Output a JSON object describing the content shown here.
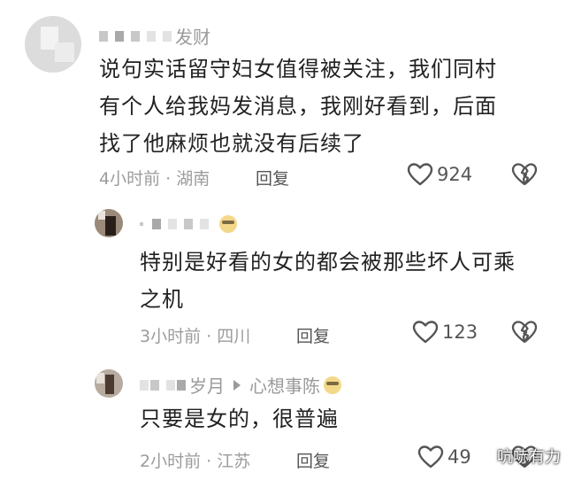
{
  "comments": [
    {
      "name_visible": "发财",
      "text": "说句实话留守妇女值得被关注，我们同村有个人给我妈发消息，我刚好看到，后面找了他麻烦也就没有后续了",
      "lines": [
        "说句实话留守妇女值得被关注，我们同村",
        "有个人给我妈发消息，我刚好看到，后面",
        "找了他麻烦也就没有后续了"
      ],
      "time": "4小时前",
      "location": "湖南",
      "reply_label": "回复",
      "likes": "924"
    },
    {
      "text": "特别是好看的女的都会被那些坏人可乘之机",
      "lines": [
        "特别是好看的女的都会被那些坏人可乘",
        "之机"
      ],
      "time": "3小时前",
      "location": "四川",
      "reply_label": "回复",
      "likes": "123"
    },
    {
      "name_visible": "岁月",
      "reply_to": "心想事陈",
      "text": "只要是女的，很普遍",
      "lines": [
        "只要是女的，很普遍"
      ],
      "time": "2小时前",
      "location": "江苏",
      "reply_label": "回复",
      "likes": "49"
    }
  ],
  "meta_separator": " · ",
  "watermark": "吭哧有力",
  "colors": {
    "text": "#222222",
    "meta": "#9c9c9c",
    "icon": "#555555"
  },
  "icons": [
    "heart-icon",
    "broken-heart-icon",
    "cool-emoji-icon",
    "reply-arrow-icon"
  ]
}
